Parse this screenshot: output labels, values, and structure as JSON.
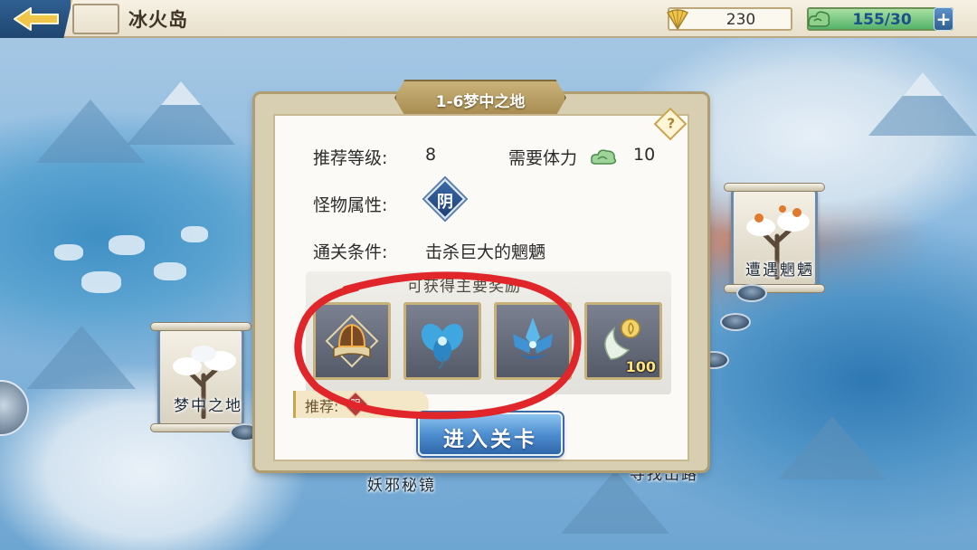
{
  "header": {
    "title": "冰火岛",
    "gold": "230",
    "energy": "155/30",
    "plus_label": "+"
  },
  "map": {
    "nodes": [
      {
        "label": "梦中之地"
      },
      {
        "label": "遭遇魍魉"
      },
      {
        "label": "妖邪秘镜"
      },
      {
        "label": "寻找出路"
      }
    ]
  },
  "dialog": {
    "title": "1-6梦中之地",
    "help_label": "?",
    "recommended_level_label": "推荐等级:",
    "recommended_level": "8",
    "stamina_label": "需要体力",
    "stamina_cost": "10",
    "monster_attr_label": "怪物属性:",
    "monster_attr": "阴",
    "clear_condition_label": "通关条件:",
    "clear_condition": "击杀巨大的魍魉",
    "reward_caption": "可获得主要奖励",
    "rewards": [
      {
        "icon": "book-helmet-icon",
        "count": ""
      },
      {
        "icon": "blue-orchid-icon",
        "count": ""
      },
      {
        "icon": "ice-lotus-icon",
        "count": ""
      },
      {
        "icon": "jade-crescent-icon",
        "count": "100"
      }
    ],
    "recommend_label": "推荐:",
    "recommend_badge": "阴",
    "enter_label": "进入关卡"
  },
  "colors": {
    "accent_blue": "#3b6aa8",
    "frame_gold": "#c9b27a",
    "annotation_red": "#e0262b"
  }
}
